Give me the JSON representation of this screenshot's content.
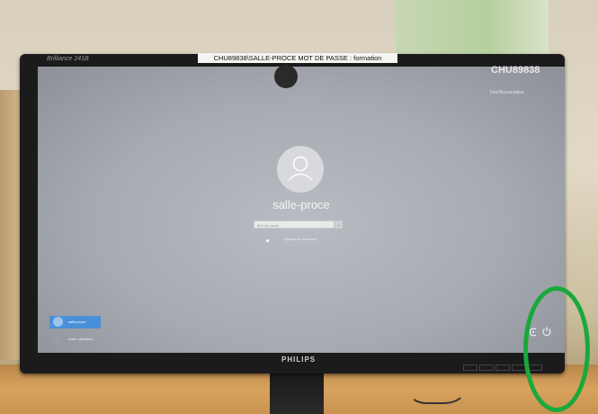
{
  "monitor": {
    "brand_top": "Brilliance 241B",
    "brand_bottom": "PHILIPS",
    "sticker": "CHU89838\\SALLE-PROCE     MOT DE PASSE : formation"
  },
  "screen": {
    "pc_name": "CHU89838",
    "service_label": "Fixe/Bureautique",
    "user": {
      "name": "salle-proce",
      "password_placeholder": "Mot de passe",
      "submit_glyph": "→"
    },
    "sign_in_options": "Options de connexion",
    "users_list": [
      {
        "label": "salle-proce"
      },
      {
        "label": "Autre utilisateur"
      }
    ],
    "icons": [
      "accessibility-icon",
      "power-icon"
    ]
  },
  "annotation": {
    "circle_color": "#19a83b"
  }
}
